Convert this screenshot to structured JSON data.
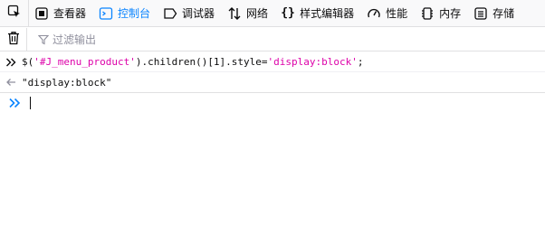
{
  "toolbar": {
    "tabs": [
      {
        "label": "查看器",
        "icon": "inspector-icon"
      },
      {
        "label": "控制台",
        "icon": "console-icon",
        "active": true
      },
      {
        "label": "调试器",
        "icon": "debugger-icon"
      },
      {
        "label": "网络",
        "icon": "network-icon"
      },
      {
        "label": "样式编辑器",
        "icon": "style-editor-icon"
      },
      {
        "label": "性能",
        "icon": "performance-icon"
      },
      {
        "label": "内存",
        "icon": "memory-icon"
      },
      {
        "label": "存储",
        "icon": "storage-icon"
      }
    ]
  },
  "filter": {
    "placeholder": "过滤输出"
  },
  "console": {
    "command": {
      "part1": "$(",
      "arg": "'#J_menu_product'",
      "part2": ").children()[1].style=",
      "value": "'display:block'",
      "part3": ";"
    },
    "result": "\"display:block\""
  },
  "colors": {
    "accent": "#0a84ff",
    "string": "#dd00a9"
  }
}
